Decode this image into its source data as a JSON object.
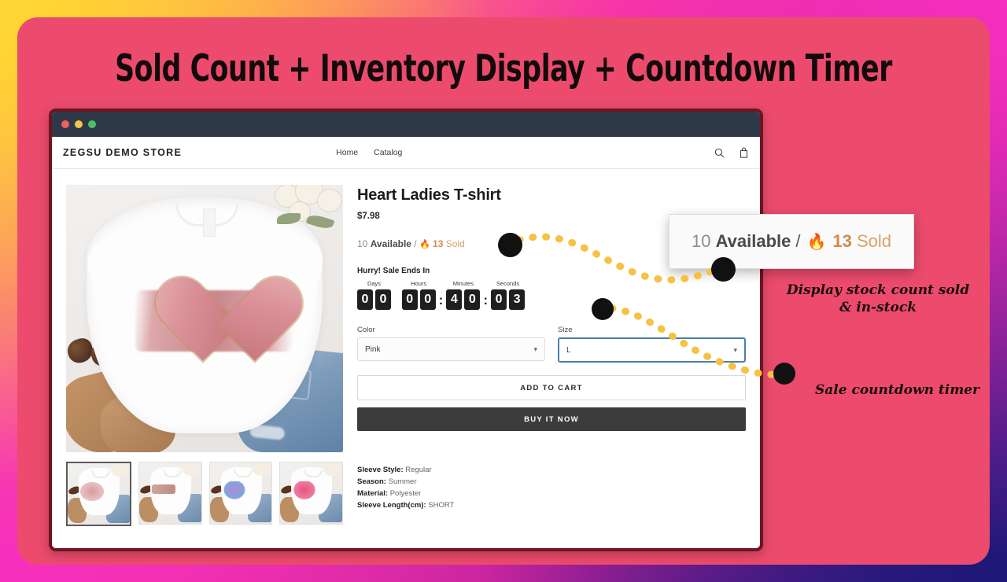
{
  "headline": "Sold Count + Inventory Display + Countdown Timer",
  "theme": {
    "card_bg": "#ec4b6d",
    "accent_dots": "#f5c242",
    "titlebar": "#2e3847",
    "sold_orange": "#d08a4e",
    "focus_blue": "#4b7fae"
  },
  "browser": {
    "dots": [
      "red",
      "yellow",
      "green"
    ]
  },
  "store": {
    "brand": "ZEGSU DEMO STORE",
    "nav": [
      {
        "label": "Home"
      },
      {
        "label": "Catalog"
      }
    ],
    "icons": [
      {
        "name": "search-icon"
      },
      {
        "name": "shopping-bag-icon"
      }
    ]
  },
  "product": {
    "title": "Heart Ladies T-shirt",
    "price": "$7.98",
    "stock": {
      "available_count": "10",
      "available_label": "Available",
      "separator": "/",
      "fire": "🔥",
      "sold_count": "13",
      "sold_label": "Sold"
    },
    "urgency_label": "Hurry! Sale Ends In",
    "timer": {
      "days": {
        "label": "Days",
        "value": "00"
      },
      "hours": {
        "label": "Hours",
        "value": "00"
      },
      "minutes": {
        "label": "Minutes",
        "value": "40"
      },
      "seconds": {
        "label": "Seconds",
        "value": "03"
      },
      "sep": ":"
    },
    "options": [
      {
        "label": "Color",
        "value": "Pink",
        "focused": false
      },
      {
        "label": "Size",
        "value": "L",
        "focused": true
      }
    ],
    "buttons": {
      "add_to_cart": "ADD TO CART",
      "buy_it_now": "BUY IT NOW"
    },
    "specs": [
      {
        "key": "Sleeve Style:",
        "value": "Regular"
      },
      {
        "key": "Season:",
        "value": "Summer"
      },
      {
        "key": "Material:",
        "value": "Polyester"
      },
      {
        "key": "Sleeve Length(cm):",
        "value": "SHORT"
      }
    ],
    "thumbnails": [
      {
        "name": "thumbnail-1",
        "selected": true
      },
      {
        "name": "thumbnail-2",
        "selected": false
      },
      {
        "name": "thumbnail-3",
        "selected": false
      },
      {
        "name": "thumbnail-4",
        "selected": false
      }
    ]
  },
  "callout": {
    "available_count": "10",
    "available_label": "Available",
    "separator": "/",
    "fire": "🔥",
    "sold_count": "13",
    "sold_label": "Sold"
  },
  "annotations": [
    {
      "text": "Display stock count sold & in-stock"
    },
    {
      "text": "Sale countdown timer"
    }
  ]
}
